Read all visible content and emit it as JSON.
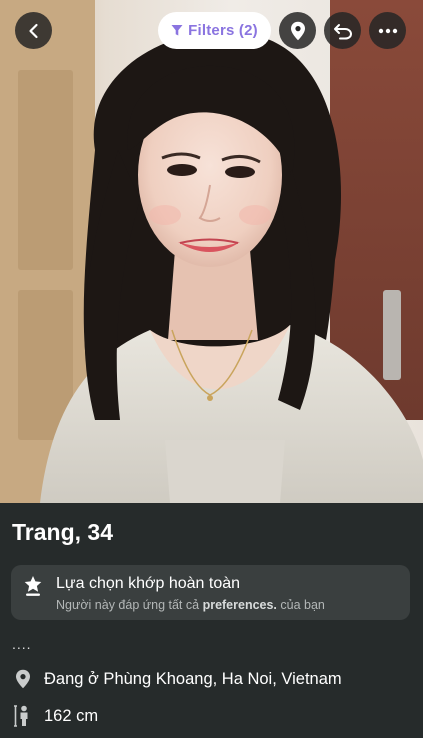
{
  "header": {
    "back_icon": "chevron-left-icon",
    "filters_label": "Filters (2)",
    "filters_icon": "funnel-icon",
    "location_icon": "map-pin-icon",
    "undo_icon": "undo-icon",
    "more_icon": "ellipsis-icon"
  },
  "profile": {
    "name_age": "Trang, 34",
    "match": {
      "icon": "star-badge-icon",
      "title": "Lựa chọn khớp hoàn toàn",
      "subtitle_prefix": "Người này đáp ứng tất cả",
      "subtitle_bold": "preferences.",
      "subtitle_suffix": "của bạn"
    },
    "bio": "....",
    "location": "Đang ở Phùng Khoang, Ha Noi, Vietnam",
    "location_icon": "map-pin-icon",
    "height": "162 cm",
    "height_icon": "person-height-icon"
  },
  "colors": {
    "accent": "#8a74e0",
    "panel_bg": "#262b2b",
    "card_bg": "#3a3f3f",
    "button_bg": "#262626"
  }
}
